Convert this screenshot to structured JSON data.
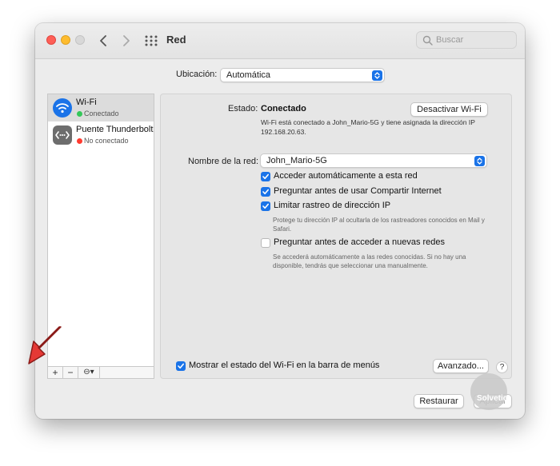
{
  "window": {
    "title": "Red"
  },
  "search": {
    "placeholder": "Buscar"
  },
  "location": {
    "label": "Ubicación:",
    "value": "Automática"
  },
  "services": [
    {
      "name": "Wi-Fi",
      "status": "Conectado",
      "status_color": "#34c759",
      "icon": "wifi-icon",
      "selected": true
    },
    {
      "name": "Puente Thunderbolt",
      "status": "No conectado",
      "status_color": "#ff3b30",
      "icon": "thunderbolt-bridge-icon",
      "selected": false
    }
  ],
  "sidebar_toolbar": {
    "add": "+",
    "remove": "−",
    "actions": "⊖▾"
  },
  "status": {
    "label": "Estado:",
    "value": "Conectado",
    "toggle_button": "Desactivar Wi-Fi",
    "description": "Wi-Fi está conectado a John_Mario-5G y tiene asignada la dirección IP 192.168.20.63."
  },
  "network": {
    "label": "Nombre de la red:",
    "value": "John_Mario-5G"
  },
  "options": [
    {
      "label": "Acceder automáticamente a esta red",
      "checked": true
    },
    {
      "label": "Preguntar antes de usar Compartir Internet",
      "checked": true
    },
    {
      "label": "Limitar rastreo de dirección IP",
      "checked": true
    },
    {
      "label": "Preguntar antes de acceder a nuevas redes",
      "checked": false
    }
  ],
  "hints": {
    "limit_ip": "Protege tu dirección IP al ocultarla de los rastreadores conocidos en Mail y Safari.",
    "ask_networks": "Se accederá automáticamente a las redes conocidas. Si no hay una disponible, tendrás que seleccionar una manualmente."
  },
  "menubar_option": {
    "label": "Mostrar el estado del Wi-Fi en la barra de menús",
    "checked": true
  },
  "buttons": {
    "advanced": "Avanzado...",
    "help": "?",
    "restore": "Restaurar",
    "apply": "Aplicar"
  },
  "watermark": {
    "text": "Solvetic"
  },
  "colors": {
    "accent": "#1a73e8",
    "annotation_arrow": "#e53935"
  }
}
